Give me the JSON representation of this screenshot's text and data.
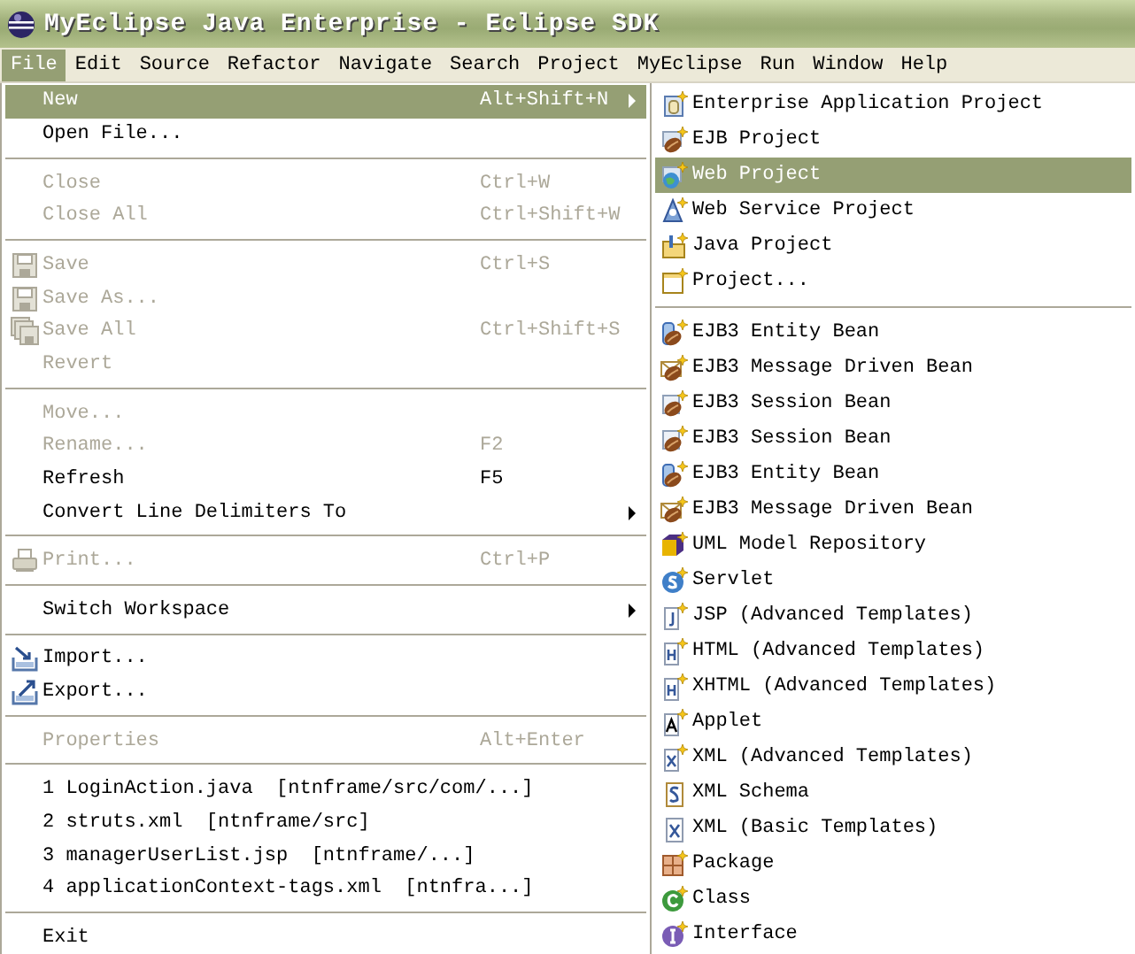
{
  "window": {
    "title": "MyEclipse Java Enterprise - Eclipse SDK"
  },
  "menubar": [
    {
      "label": "File",
      "selected": true
    },
    {
      "label": "Edit",
      "selected": false
    },
    {
      "label": "Source",
      "selected": false
    },
    {
      "label": "Refactor",
      "selected": false
    },
    {
      "label": "Navigate",
      "selected": false
    },
    {
      "label": "Search",
      "selected": false
    },
    {
      "label": "Project",
      "selected": false
    },
    {
      "label": "MyEclipse",
      "selected": false
    },
    {
      "label": "Run",
      "selected": false
    },
    {
      "label": "Window",
      "selected": false
    },
    {
      "label": "Help",
      "selected": false
    }
  ],
  "file_menu": [
    {
      "kind": "item",
      "label": "New",
      "shortcut": "Alt+Shift+N",
      "submenu": true,
      "disabled": false,
      "selected": true
    },
    {
      "kind": "item",
      "label": "Open File...",
      "disabled": false,
      "selected": false
    },
    {
      "kind": "separator"
    },
    {
      "kind": "item",
      "label": "Close",
      "shortcut": "Ctrl+W",
      "disabled": true,
      "selected": false
    },
    {
      "kind": "item",
      "label": "Close All",
      "shortcut": "Ctrl+Shift+W",
      "disabled": true,
      "selected": false
    },
    {
      "kind": "separator"
    },
    {
      "kind": "item",
      "label": "Save",
      "shortcut": "Ctrl+S",
      "disabled": true,
      "selected": false
    },
    {
      "kind": "item",
      "label": "Save As...",
      "disabled": true,
      "selected": false
    },
    {
      "kind": "item",
      "label": "Save All",
      "shortcut": "Ctrl+Shift+S",
      "disabled": true,
      "selected": false
    },
    {
      "kind": "item",
      "label": "Revert",
      "disabled": true,
      "selected": false
    },
    {
      "kind": "separator"
    },
    {
      "kind": "item",
      "label": "Move...",
      "disabled": true,
      "selected": false
    },
    {
      "kind": "item",
      "label": "Rename...",
      "shortcut": "F2",
      "disabled": true,
      "selected": false
    },
    {
      "kind": "item",
      "label": "Refresh",
      "shortcut": "F5",
      "disabled": false,
      "selected": false
    },
    {
      "kind": "item",
      "label": "Convert Line Delimiters To",
      "submenu": true,
      "disabled": false,
      "selected": false
    },
    {
      "kind": "separator"
    },
    {
      "kind": "item",
      "label": "Print...",
      "shortcut": "Ctrl+P",
      "disabled": true,
      "selected": false
    },
    {
      "kind": "separator"
    },
    {
      "kind": "item",
      "label": "Switch Workspace",
      "submenu": true,
      "disabled": false,
      "selected": false
    },
    {
      "kind": "separator"
    },
    {
      "kind": "item",
      "label": "Import...",
      "disabled": false,
      "selected": false
    },
    {
      "kind": "item",
      "label": "Export...",
      "disabled": false,
      "selected": false
    },
    {
      "kind": "separator"
    },
    {
      "kind": "item",
      "label": "Properties",
      "shortcut": "Alt+Enter",
      "disabled": true,
      "selected": false
    },
    {
      "kind": "separator"
    },
    {
      "kind": "item",
      "label": "1 LoginAction.java  [ntnframe/src/com/...]",
      "disabled": false,
      "selected": false
    },
    {
      "kind": "item",
      "label": "2 struts.xml  [ntnframe/src]",
      "disabled": false,
      "selected": false
    },
    {
      "kind": "item",
      "label": "3 managerUserList.jsp  [ntnframe/...]",
      "disabled": false,
      "selected": false
    },
    {
      "kind": "item",
      "label": "4 applicationContext-tags.xml  [ntnfra...]",
      "disabled": false,
      "selected": false
    },
    {
      "kind": "separator"
    },
    {
      "kind": "item",
      "label": "Exit",
      "disabled": false,
      "selected": false
    }
  ],
  "new_submenu": [
    {
      "kind": "item",
      "label": "Enterprise Application Project",
      "selected": false
    },
    {
      "kind": "item",
      "label": "EJB Project",
      "selected": false
    },
    {
      "kind": "item",
      "label": "Web Project",
      "selected": true
    },
    {
      "kind": "item",
      "label": "Web Service Project",
      "selected": false
    },
    {
      "kind": "item",
      "label": "Java Project",
      "selected": false
    },
    {
      "kind": "item",
      "label": "Project...",
      "selected": false
    },
    {
      "kind": "separator"
    },
    {
      "kind": "item",
      "label": "EJB3 Entity Bean",
      "selected": false
    },
    {
      "kind": "item",
      "label": "EJB3 Message Driven Bean",
      "selected": false
    },
    {
      "kind": "item",
      "label": "EJB3 Session Bean",
      "selected": false
    },
    {
      "kind": "item",
      "label": "EJB3 Session Bean",
      "selected": false
    },
    {
      "kind": "item",
      "label": "EJB3 Entity Bean",
      "selected": false
    },
    {
      "kind": "item",
      "label": "EJB3 Message Driven Bean",
      "selected": false
    },
    {
      "kind": "item",
      "label": "UML Model Repository",
      "selected": false
    },
    {
      "kind": "item",
      "label": "Servlet",
      "selected": false
    },
    {
      "kind": "item",
      "label": "JSP (Advanced Templates)",
      "selected": false
    },
    {
      "kind": "item",
      "label": "HTML (Advanced Templates)",
      "selected": false
    },
    {
      "kind": "item",
      "label": "XHTML (Advanced Templates)",
      "selected": false
    },
    {
      "kind": "item",
      "label": "Applet",
      "selected": false
    },
    {
      "kind": "item",
      "label": "XML (Advanced Templates)",
      "selected": false
    },
    {
      "kind": "item",
      "label": "XML Schema",
      "selected": false
    },
    {
      "kind": "item",
      "label": "XML (Basic Templates)",
      "selected": false
    },
    {
      "kind": "item",
      "label": "Package",
      "selected": false
    },
    {
      "kind": "item",
      "label": "Class",
      "selected": false
    },
    {
      "kind": "item",
      "label": "Interface",
      "selected": false
    }
  ]
}
